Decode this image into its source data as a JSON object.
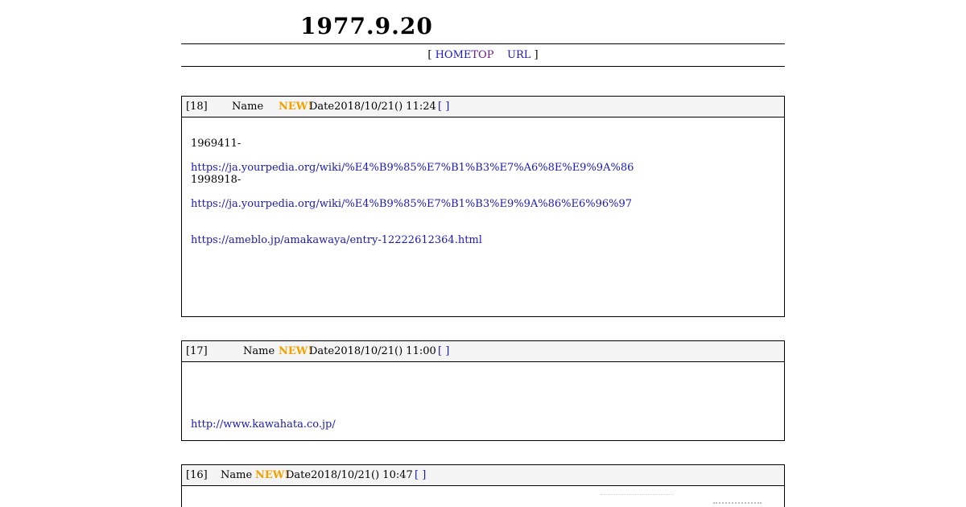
{
  "header": {
    "title": "1977.9.20"
  },
  "nav": {
    "open": "[",
    "home": "HOME",
    "top": "TOP",
    "url": "URL",
    "close": "]"
  },
  "posts": [
    {
      "number": "[18]",
      "name_label": "Name",
      "new_badge": "NEW!",
      "date_text": "Date2018/10/21() 11:24",
      "action": "[ ]",
      "lines": [
        {
          "text": "1969411-",
          "link": false
        },
        {
          "text": "https://ja.yourpedia.org/wiki/%E4%B9%85%E7%B1%B3%E7%A6%8E%E9%9A%86",
          "link": true
        },
        {
          "text": "1998918-",
          "link": false
        },
        {
          "text": "https://ja.yourpedia.org/wiki/%E4%B9%85%E7%B1%B3%E9%9A%86%E6%96%97",
          "link": true
        },
        {
          "text": "https://ameblo.jp/amakawaya/entry-12222612364.html",
          "link": true
        }
      ]
    },
    {
      "number": "[17]",
      "name_label": "Name",
      "new_badge": "NEW!",
      "date_text": "Date2018/10/21() 11:00",
      "action": "[ ]",
      "lines": [
        {
          "text": "http://www.kawahata.co.jp/",
          "link": true
        }
      ]
    },
    {
      "number": "[16]",
      "name_label": "Name",
      "new_badge": "NEW!",
      "date_text": "Date2018/10/21() 10:47",
      "action": "[ ]",
      "lines": []
    }
  ]
}
